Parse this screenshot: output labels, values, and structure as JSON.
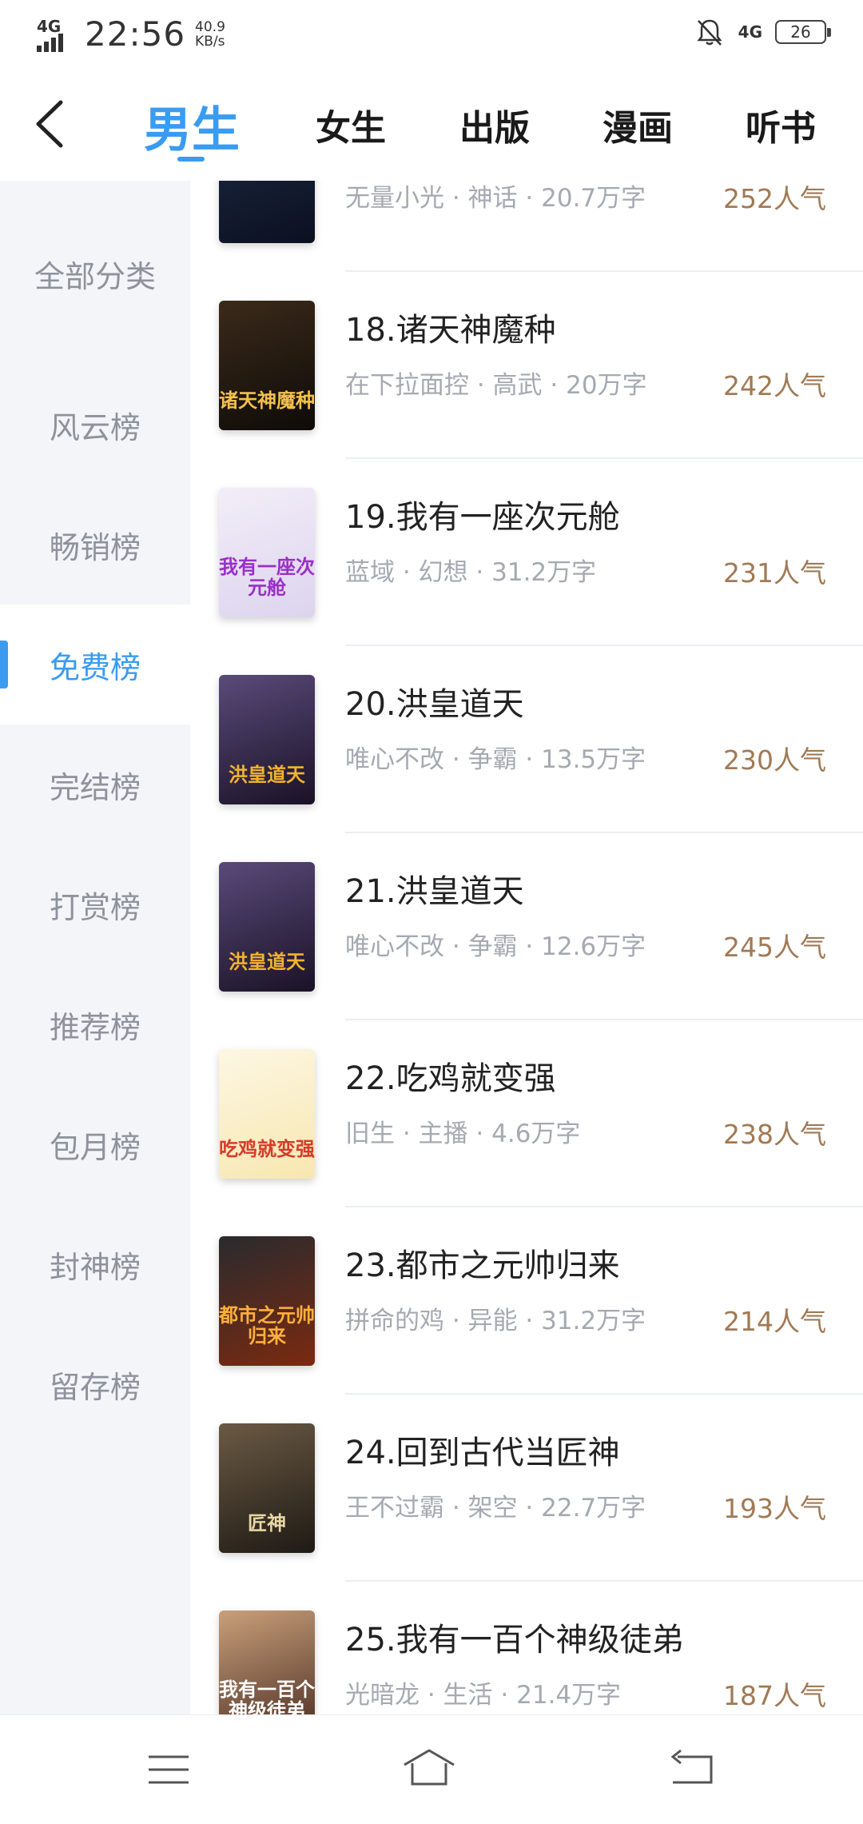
{
  "status_bar": {
    "network": "4G",
    "time": "22:56",
    "speed_value": "40.9",
    "speed_unit": "KB/s",
    "network2": "4G",
    "battery": "26"
  },
  "header": {
    "tabs": [
      "男生",
      "女生",
      "出版",
      "漫画",
      "听书"
    ]
  },
  "sidebar": {
    "items": [
      "全部分类",
      "风云榜",
      "畅销榜",
      "免费榜",
      "完结榜",
      "打赏榜",
      "推荐榜",
      "包月榜",
      "封神榜",
      "留存榜"
    ],
    "active_index": 3
  },
  "books": [
    {
      "title": "",
      "meta": "无量小光 · 神话 · 20.7万字",
      "popularity": "252人气",
      "cover_text": "",
      "cover_colors": [
        "#1d2a45",
        "#0b1020"
      ],
      "cover_text_color": "#cfd8ff"
    },
    {
      "title": "18.诸天神魔种",
      "meta": "在下拉面控 · 高武 · 20万字",
      "popularity": "242人气",
      "cover_text": "诸天神魔种",
      "cover_colors": [
        "#3b2a1a",
        "#0e0b08"
      ],
      "cover_text_color": "#f3c04a"
    },
    {
      "title": "19.我有一座次元舱",
      "meta": "蓝域 · 幻想 · 31.2万字",
      "popularity": "231人气",
      "cover_text": "我有一座次元舱",
      "cover_colors": [
        "#f2eef8",
        "#dcd4ee"
      ],
      "cover_text_color": "#9b2fc8"
    },
    {
      "title": "20.洪皇道天",
      "meta": "唯心不改 · 争霸 · 13.5万字",
      "popularity": "230人气",
      "cover_text": "洪皇道天",
      "cover_colors": [
        "#5a4a7a",
        "#1a1226"
      ],
      "cover_text_color": "#f2b32e"
    },
    {
      "title": "21.洪皇道天",
      "meta": "唯心不改 · 争霸 · 12.6万字",
      "popularity": "245人气",
      "cover_text": "洪皇道天",
      "cover_colors": [
        "#5a4a7a",
        "#1a1226"
      ],
      "cover_text_color": "#f2b32e"
    },
    {
      "title": "22.吃鸡就变强",
      "meta": "旧生 · 主播 · 4.6万字",
      "popularity": "238人气",
      "cover_text": "吃鸡就变强",
      "cover_colors": [
        "#fdf7e3",
        "#f7e7b0"
      ],
      "cover_text_color": "#d63b2a"
    },
    {
      "title": "23.都市之元帅归来",
      "meta": "拼命的鸡 · 异能 · 31.2万字",
      "popularity": "214人气",
      "cover_text": "都市之元帅归来",
      "cover_colors": [
        "#2a2a2e",
        "#7a2a10"
      ],
      "cover_text_color": "#ffb03a"
    },
    {
      "title": "24.回到古代当匠神",
      "meta": "王不过霸 · 架空 · 22.7万字",
      "popularity": "193人气",
      "cover_text": "匠神",
      "cover_colors": [
        "#6b5a44",
        "#1e1a14"
      ],
      "cover_text_color": "#e9d7a6"
    },
    {
      "title": "25.我有一百个神级徒弟",
      "meta": "光暗龙 · 生活 · 21.4万字",
      "popularity": "187人气",
      "cover_text": "我有一百个神级徒弟",
      "cover_colors": [
        "#c9a07a",
        "#4a2c22"
      ],
      "cover_text_color": "#ffffff"
    }
  ],
  "nav_icons": [
    "menu-icon",
    "home-icon",
    "back-icon"
  ]
}
